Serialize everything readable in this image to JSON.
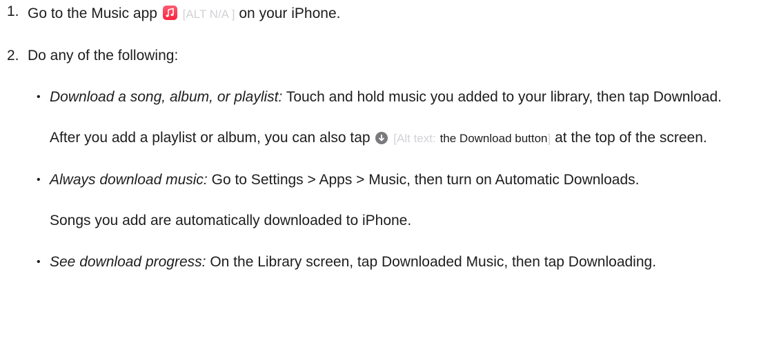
{
  "steps": [
    {
      "num": "1.",
      "before": "Go to the Music app",
      "icon": "music-app-icon",
      "alt": "[ALT N/A ]",
      "after": "on your iPhone."
    },
    {
      "num": "2.",
      "text": "Do any of the following:"
    }
  ],
  "bullets": [
    {
      "glyph": "•",
      "lead": "Download a song, album, or playlist:",
      "text": "Touch and hold music you added to your library, then tap Download.",
      "sub": {
        "before": "After you add a playlist or album, you can also tap",
        "icon": "download-icon",
        "alt_open": "[Alt text:",
        "alt_text": "the Download button",
        "alt_close": "]",
        "after": "at the top of the screen."
      }
    },
    {
      "glyph": "•",
      "lead": "Always download music:",
      "text": "Go to Settings > Apps > Music, then turn on Automatic Downloads.",
      "sub": {
        "text": "Songs you add are automatically downloaded to iPhone."
      }
    },
    {
      "glyph": "•",
      "lead": "See download progress:",
      "text": "On the Library screen, tap Downloaded Music, then tap Downloading."
    }
  ],
  "colors": {
    "text": "#1d1d1f",
    "alt_faint": "#d2d2d7",
    "music_icon": "#fa233b",
    "download_icon": "#7a7a7e"
  }
}
